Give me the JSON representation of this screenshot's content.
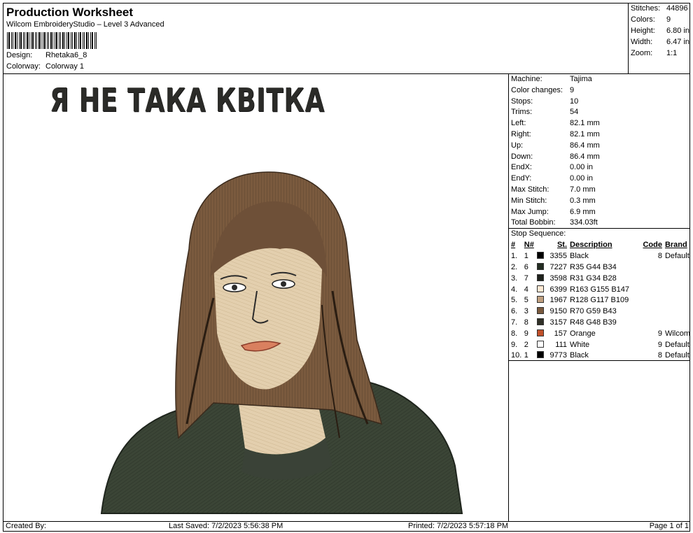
{
  "header": {
    "title": "Production Worksheet",
    "subtitle": "Wilcom EmbroideryStudio – Level 3 Advanced",
    "design_label": "Design:",
    "design_value": "Rhetaka6_8",
    "colorway_label": "Colorway:",
    "colorway_value": "Colorway 1"
  },
  "summary": [
    {
      "k": "Stitches:",
      "v": "44896"
    },
    {
      "k": "Colors:",
      "v": "9"
    },
    {
      "k": "Height:",
      "v": "6.80 in"
    },
    {
      "k": "Width:",
      "v": "6.47 in"
    },
    {
      "k": "Zoom:",
      "v": "1:1"
    }
  ],
  "machine": [
    {
      "k": "Machine:",
      "v": "Tajima"
    },
    {
      "k": "Color changes:",
      "v": "9"
    },
    {
      "k": "Stops:",
      "v": "10"
    },
    {
      "k": "Trims:",
      "v": "54"
    },
    {
      "k": "Left:",
      "v": "82.1 mm"
    },
    {
      "k": "Right:",
      "v": "82.1 mm"
    },
    {
      "k": "Up:",
      "v": "86.4 mm"
    },
    {
      "k": "Down:",
      "v": "86.4 mm"
    },
    {
      "k": "EndX:",
      "v": "0.00 in"
    },
    {
      "k": "EndY:",
      "v": "0.00 in"
    },
    {
      "k": "Max Stitch:",
      "v": "7.0 mm"
    },
    {
      "k": "Min Stitch:",
      "v": "0.3 mm"
    },
    {
      "k": "Max Jump:",
      "v": "6.9 mm"
    },
    {
      "k": "Total Bobbin:",
      "v": "334.03ft"
    }
  ],
  "stop_sequence": {
    "caption": "Stop Sequence:",
    "headers": {
      "idx": "#",
      "n": "N#",
      "st": "St.",
      "desc": "Description",
      "code": "Code",
      "brand": "Brand"
    },
    "rows": [
      {
        "idx": "1.",
        "n": "1",
        "color": "#000000",
        "st": "3355",
        "desc": "Black",
        "code": "8",
        "brand": "Default"
      },
      {
        "idx": "2.",
        "n": "6",
        "color": "#232C22",
        "st": "7227",
        "desc": "R35 G44 B34",
        "code": "",
        "brand": ""
      },
      {
        "idx": "3.",
        "n": "7",
        "color": "#1F221C",
        "st": "3598",
        "desc": "R31 G34 B28",
        "code": "",
        "brand": ""
      },
      {
        "idx": "4.",
        "n": "4",
        "color": "#FFE9D3",
        "st": "6399",
        "desc": "R163 G155 B147",
        "code": "",
        "brand": ""
      },
      {
        "idx": "5.",
        "n": "5",
        "color": "#C0A080",
        "st": "1967",
        "desc": "R128 G117 B109",
        "code": "",
        "brand": ""
      },
      {
        "idx": "6.",
        "n": "3",
        "color": "#7A5A3E",
        "st": "9150",
        "desc": "R70 G59 B43",
        "code": "",
        "brand": ""
      },
      {
        "idx": "7.",
        "n": "8",
        "color": "#303027",
        "st": "3157",
        "desc": "R48 G48 B39",
        "code": "",
        "brand": ""
      },
      {
        "idx": "8.",
        "n": "9",
        "color": "#C0502A",
        "st": "157",
        "desc": "Orange",
        "code": "9",
        "brand": "Wilcom"
      },
      {
        "idx": "9.",
        "n": "2",
        "color": "#FFFFFF",
        "st": "111",
        "desc": "White",
        "code": "9",
        "brand": "Default"
      },
      {
        "idx": "10.",
        "n": "1",
        "color": "#000000",
        "st": "9773",
        "desc": "Black",
        "code": "8",
        "brand": "Default"
      }
    ]
  },
  "design": {
    "caption_text": "Я НЕ ТАКА КВІТКА"
  },
  "footer": {
    "created_by": "Created By:",
    "last_saved": "Last Saved: 7/2/2023 5:56:38 PM",
    "printed": "Printed: 7/2/2023 5:57:18 PM",
    "page": "Page 1 of 1"
  }
}
